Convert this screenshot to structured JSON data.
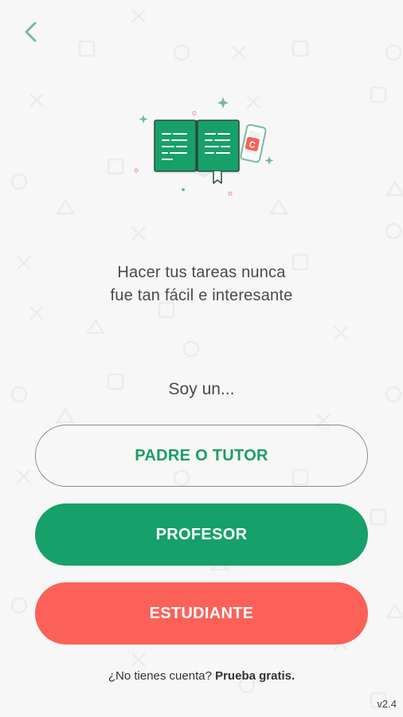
{
  "header": {
    "back_icon": "chevron-left-icon",
    "accent_color": "#7bb8a0"
  },
  "tagline": {
    "line1": "Hacer tus tareas nunca",
    "line2": "fue tan fácil e interesante"
  },
  "prompt": "Soy un...",
  "buttons": {
    "parent_label": "PADRE O TUTOR",
    "teacher_label": "PROFESOR",
    "student_label": "ESTUDIANTE"
  },
  "signup": {
    "question": "¿No tienes cuenta?",
    "link": "Prueba gratis."
  },
  "version": "v2.4",
  "colors": {
    "green": "#17a06a",
    "coral": "#fb6159",
    "background": "#f7f7f7"
  },
  "illustration": {
    "phone_letter": "C"
  }
}
